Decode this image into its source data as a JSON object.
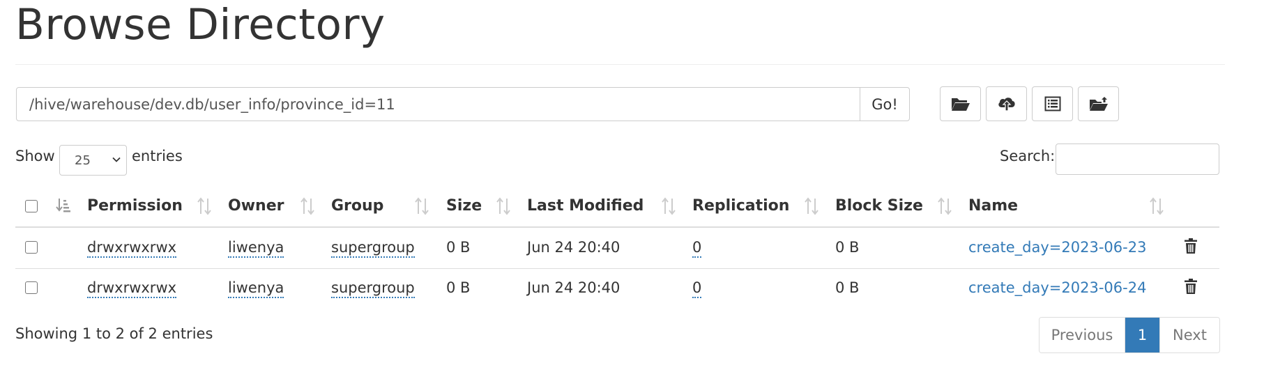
{
  "page": {
    "title": "Browse Directory"
  },
  "path_bar": {
    "value": "/hive/warehouse/dev.db/user_info/province_id=11",
    "go_label": "Go!"
  },
  "toolbar": {
    "buttons": [
      {
        "icon": "folder-open-icon"
      },
      {
        "icon": "cloud-upload-icon"
      },
      {
        "icon": "list-alt-icon"
      },
      {
        "icon": "folder-upload-icon"
      }
    ]
  },
  "length": {
    "show_label": "Show",
    "selected": "25",
    "entries_label": "entries"
  },
  "search": {
    "label": "Search:",
    "value": ""
  },
  "table": {
    "columns": [
      "Permission",
      "Owner",
      "Group",
      "Size",
      "Last Modified",
      "Replication",
      "Block Size",
      "Name"
    ],
    "rows": [
      {
        "permission": "drwxrwxrwx",
        "owner": "liwenya",
        "group": "supergroup",
        "size": "0 B",
        "last_modified": "Jun 24 20:40",
        "replication": "0",
        "block_size": "0 B",
        "name": "create_day=2023-06-23"
      },
      {
        "permission": "drwxrwxrwx",
        "owner": "liwenya",
        "group": "supergroup",
        "size": "0 B",
        "last_modified": "Jun 24 20:40",
        "replication": "0",
        "block_size": "0 B",
        "name": "create_day=2023-06-24"
      }
    ]
  },
  "footer": {
    "info": "Showing 1 to 2 of 2 entries"
  },
  "pagination": {
    "previous": "Previous",
    "current": "1",
    "next": "Next"
  },
  "colors": {
    "link": "#337ab7",
    "active_page": "#337ab7",
    "border": "#dddddd"
  }
}
